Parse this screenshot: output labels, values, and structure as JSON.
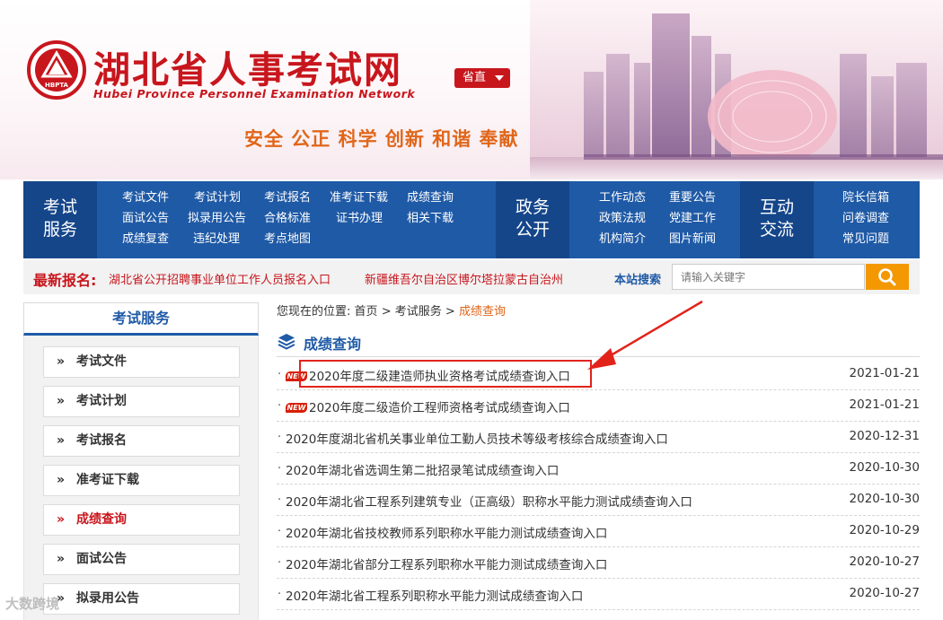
{
  "header": {
    "title": "湖北省人事考试网",
    "subtitle": "Hubei Province Personnel Examination Network",
    "logo_text": "HBPTA",
    "region_select": "省直",
    "slogan": "安全 公正 科学 创新 和谐 奉献"
  },
  "nav": {
    "blocks": [
      {
        "label": "考试\n服务",
        "links": [
          "考试文件",
          "考试计划",
          "考试报名",
          "准考证下载",
          "成绩查询",
          "面试公告",
          "拟录用公告",
          "合格标准",
          "证书办理",
          "相关下载",
          "成绩复查",
          "违纪处理",
          "考点地图"
        ]
      },
      {
        "label": "政务\n公开",
        "links": [
          "工作动态",
          "重要公告",
          "政策法规",
          "党建工作",
          "机构简介",
          "图片新闻"
        ]
      },
      {
        "label": "互动\n交流",
        "links": [
          "院长信箱",
          "问卷调查",
          "常见问题"
        ]
      }
    ]
  },
  "latest": {
    "label": "最新报名:",
    "items": [
      "湖北省公开招聘事业单位工作人员报名入口",
      "新疆维吾尔自治区博尔塔拉蒙古自治州"
    ]
  },
  "search": {
    "label": "本站搜索",
    "placeholder": "请输入关键字",
    "button_icon": "search-icon"
  },
  "sidebar": {
    "header": "考试服务",
    "items": [
      {
        "label": "考试文件",
        "active": false
      },
      {
        "label": "考试计划",
        "active": false
      },
      {
        "label": "考试报名",
        "active": false
      },
      {
        "label": "准考证下载",
        "active": false
      },
      {
        "label": "成绩查询",
        "active": true
      },
      {
        "label": "面试公告",
        "active": false
      },
      {
        "label": "拟录用公告",
        "active": false
      }
    ]
  },
  "breadcrumb": {
    "prefix": "您现在的位置:",
    "items": [
      "首页",
      "考试服务",
      "成绩查询"
    ],
    "separator": ">"
  },
  "section": {
    "title": "成绩查询"
  },
  "list": [
    {
      "title": "2020年度二级建造师执业资格考试成绩查询入口",
      "date": "2021-01-21",
      "new": true,
      "badge": "NEW"
    },
    {
      "title": "2020年度二级造价工程师资格考试成绩查询入口",
      "date": "2021-01-21",
      "new": true,
      "badge": "NEW"
    },
    {
      "title": "2020年度湖北省机关事业单位工勤人员技术等级考核综合成绩查询入口",
      "date": "2020-12-31",
      "new": false
    },
    {
      "title": "2020年湖北省选调生第二批招录笔试成绩查询入口",
      "date": "2020-10-30",
      "new": false
    },
    {
      "title": "2020年湖北省工程系列建筑专业（正高级）职称水平能力测试成绩查询入口",
      "date": "2020-10-30",
      "new": false
    },
    {
      "title": "2020年湖北省技校教师系列职称水平能力测试成绩查询入口",
      "date": "2020-10-29",
      "new": false
    },
    {
      "title": "2020年湖北省部分工程系列职称水平能力测试成绩查询入口",
      "date": "2020-10-27",
      "new": false
    },
    {
      "title": "2020年湖北省工程系列职称水平能力测试成绩查询入口",
      "date": "2020-10-27",
      "new": false
    }
  ],
  "watermark": "大数跨境",
  "colors": {
    "brand_red": "#c8161d",
    "nav_blue": "#1f5aa6",
    "nav_dark": "#15468a",
    "accent_orange": "#f39800",
    "slogan_orange": "#e0661a"
  }
}
